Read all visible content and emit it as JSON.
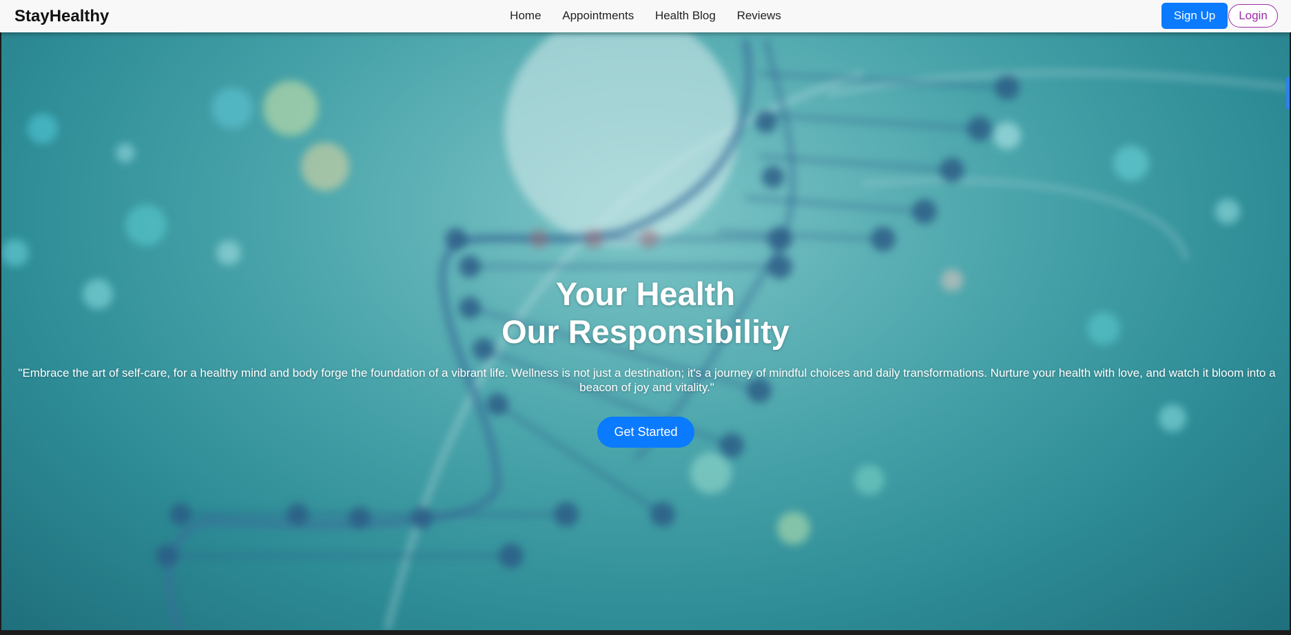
{
  "navbar": {
    "logo": "StayHealthy",
    "links": [
      "Home",
      "Appointments",
      "Health Blog",
      "Reviews"
    ],
    "signup_label": "Sign Up",
    "login_label": "Login"
  },
  "hero": {
    "headline_line1": "Your Health",
    "headline_line2": "Our Responsibility",
    "quote": "\"Embrace the art of self-care, for a healthy mind and body forge the foundation of a vibrant life. Wellness is not just a destination; it's a journey of mindful choices and daily transformations. Nurture your health with love, and watch it bloom into a beacon of joy and vitality.\"",
    "cta_label": "Get Started",
    "background_image": "dna-helix"
  },
  "colors": {
    "primary": "#0a7aff",
    "login_accent": "#9b2aa6",
    "navbar_bg": "#f8f8f8"
  }
}
